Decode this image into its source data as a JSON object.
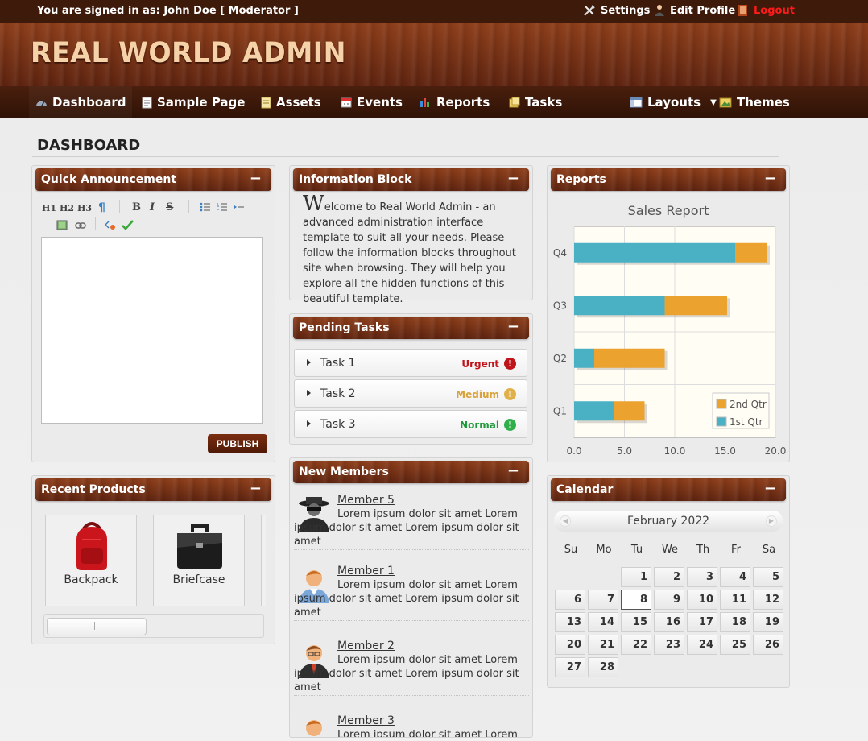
{
  "topbar": {
    "signed_in": "You are signed in as: John Doe [ Moderator ]",
    "settings": "Settings",
    "edit_profile": "Edit Profile",
    "logout": "Logout",
    "logout_color": "#ff1a1a"
  },
  "banner": {
    "logo": "REAL WORLD ADMIN"
  },
  "nav": {
    "items": [
      {
        "label": "Dashboard",
        "icon": "dashboard-icon"
      },
      {
        "label": "Sample Page",
        "icon": "page-icon"
      },
      {
        "label": "Assets",
        "icon": "assets-icon"
      },
      {
        "label": "Events",
        "icon": "calendar-icon"
      },
      {
        "label": "Reports",
        "icon": "bar-chart-icon"
      },
      {
        "label": "Tasks",
        "icon": "tasks-icon"
      }
    ],
    "layouts": "Layouts",
    "themes": "Themes"
  },
  "page_title": "DASHBOARD",
  "quick_announcement": {
    "title": "Quick Announcement",
    "toolbar": {
      "h1": "H1",
      "h2": "H2",
      "h3": "H3",
      "para": "¶",
      "bold": "B",
      "italic": "I",
      "strike": "S"
    },
    "publish": "PUBLISH"
  },
  "information_block": {
    "title": "Information Block",
    "drop_cap": "W",
    "text": "elcome to Real World Admin - an advanced administration interface template to suit all your needs. Please follow the information blocks throughout site when browsing. They will help you explore all the hidden functions of this beautiful template."
  },
  "pending_tasks": {
    "title": "Pending Tasks",
    "tasks": [
      {
        "label": "Task 1",
        "priority": "Urgent",
        "color": "#c0141b"
      },
      {
        "label": "Task 2",
        "priority": "Medium",
        "color": "#d9a23a"
      },
      {
        "label": "Task 3",
        "priority": "Normal",
        "color": "#1f9a3a"
      }
    ]
  },
  "new_members": {
    "title": "New Members",
    "members": [
      {
        "name": "Member 5",
        "text": "Lorem ipsum dolor sit amet Lorem ipsum dolor sit amet Lorem ipsum dolor sit amet"
      },
      {
        "name": "Member 1",
        "text": "Lorem ipsum dolor sit amet Lorem ipsum dolor sit amet Lorem ipsum dolor sit amet"
      },
      {
        "name": "Member 2",
        "text": "Lorem ipsum dolor sit amet Lorem ipsum dolor sit amet Lorem ipsum dolor sit amet"
      },
      {
        "name": "Member 3",
        "text": "Lorem ipsum dolor sit amet Lorem ipsum dolor sit amet Lorem ipsum dolor sit amet"
      }
    ]
  },
  "recent_products": {
    "title": "Recent Products",
    "products": [
      {
        "label": "Backpack",
        "icon": "backpack-icon"
      },
      {
        "label": "Briefcase",
        "icon": "briefcase-icon"
      }
    ]
  },
  "reports": {
    "title": "Reports",
    "chart_data": {
      "type": "bar",
      "orientation": "horizontal",
      "stacked": true,
      "title": "Sales Report",
      "categories": [
        "Q1",
        "Q2",
        "Q3",
        "Q4"
      ],
      "series": [
        {
          "name": "1st Qtr",
          "color": "#4ab1c5",
          "values": [
            4,
            2,
            9,
            16
          ]
        },
        {
          "name": "2nd Qtr",
          "color": "#eba22e",
          "values": [
            3,
            7,
            6.2,
            3.2
          ]
        }
      ],
      "xlim": [
        0,
        20
      ],
      "xticks": [
        "0.0",
        "5.0",
        "10.0",
        "15.0",
        "20.0"
      ],
      "grid": true,
      "legend_position": "bottom-right"
    }
  },
  "calendar": {
    "title": "Calendar",
    "month": "February 2022",
    "weekdays": [
      "Su",
      "Mo",
      "Tu",
      "We",
      "Th",
      "Fr",
      "Sa"
    ],
    "first_weekday_index": 2,
    "days_in_month": 28,
    "today": 8
  }
}
